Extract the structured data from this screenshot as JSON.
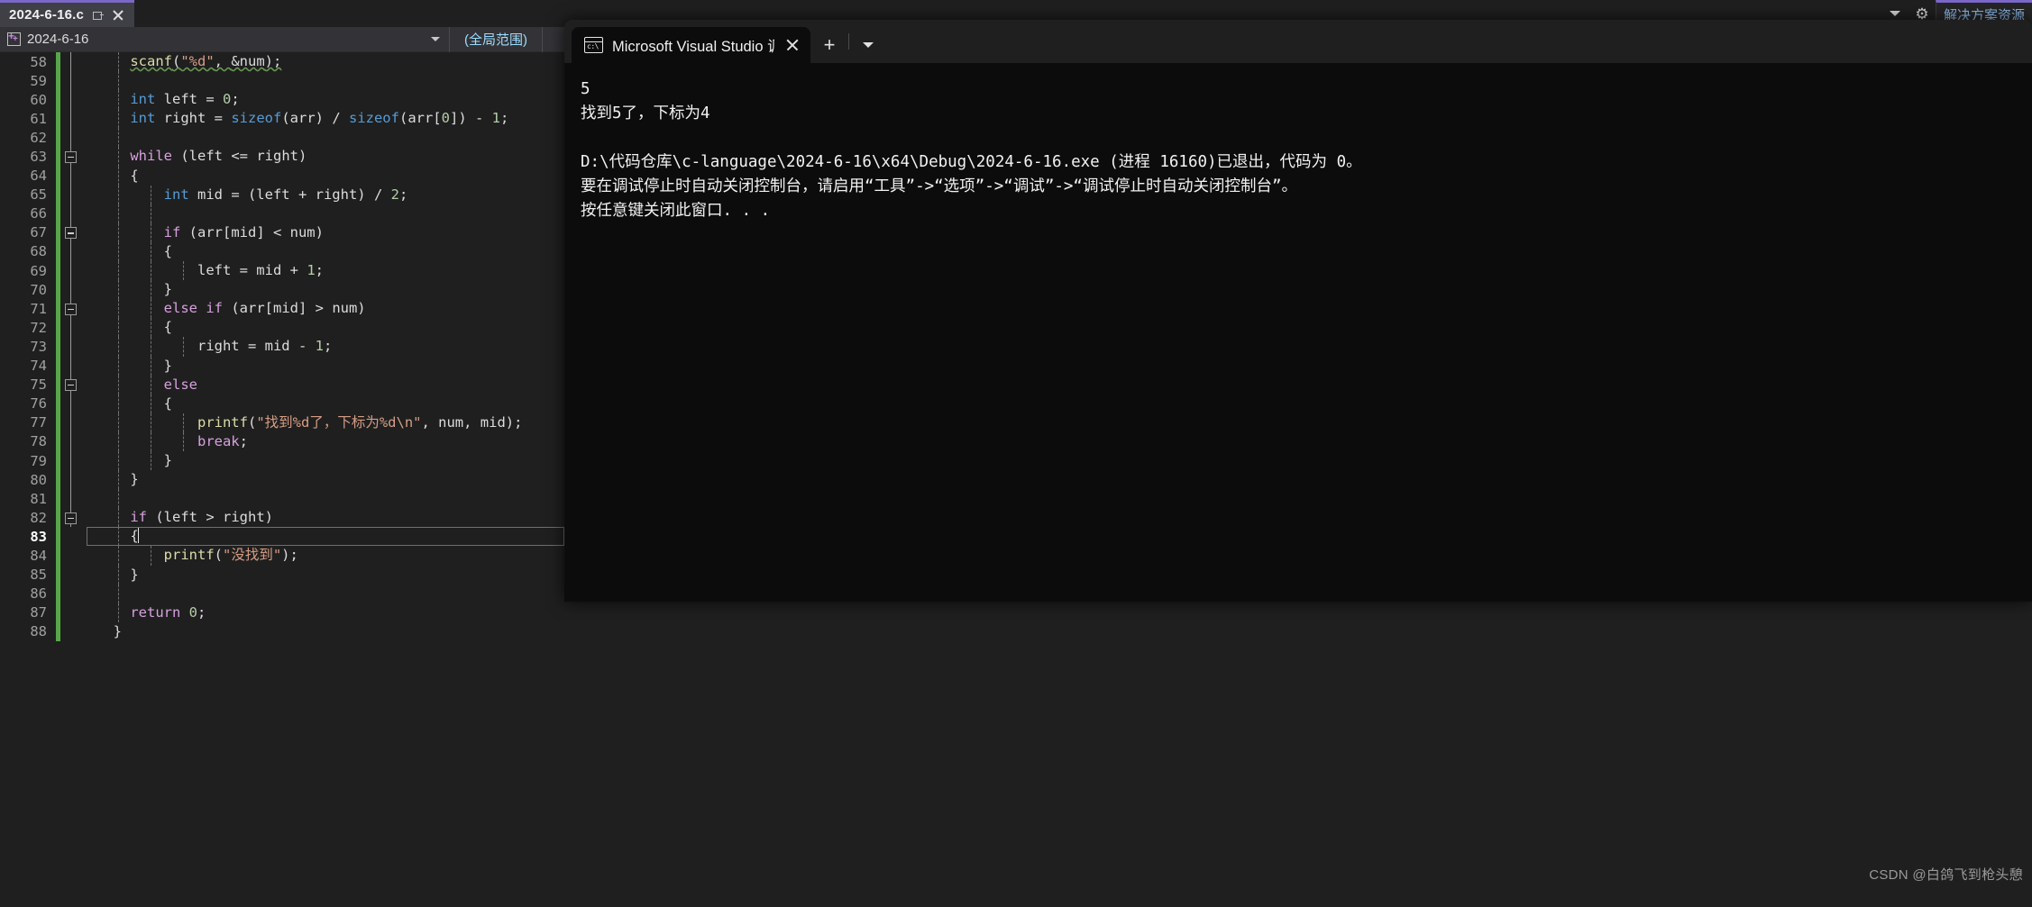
{
  "window": {
    "document_tab": {
      "title": "2024-6-16.c",
      "pin_label": "pin-tab",
      "close_label": "close-tab"
    },
    "tabstrip_right": {
      "dropdown_label": "active-files-dropdown",
      "settings_label": "settings",
      "solution_explorer_tab": "解决方案资源"
    }
  },
  "navbar": {
    "project": "2024-6-16",
    "scope": "(全局范围)"
  },
  "editor": {
    "first_line_number": 58,
    "current_line": 83,
    "lines": [
      {
        "n": 58,
        "fold": false,
        "rail": true,
        "indent_guides": 1,
        "indent": 2,
        "tokens": [
          {
            "t": "scanf",
            "c": "fn",
            "sq": true
          },
          {
            "t": "(",
            "c": "pl",
            "sq": true
          },
          {
            "t": "\"%d\"",
            "c": "str",
            "sq": true
          },
          {
            "t": ", ",
            "c": "pl",
            "sq": true
          },
          {
            "t": "&num",
            "c": "pl",
            "sq": true
          },
          {
            "t": ");",
            "c": "pl",
            "sq": true
          }
        ]
      },
      {
        "n": 59,
        "fold": false,
        "rail": true,
        "indent_guides": 1,
        "indent": 0,
        "tokens": []
      },
      {
        "n": 60,
        "fold": false,
        "rail": true,
        "indent_guides": 1,
        "indent": 2,
        "tokens": [
          {
            "t": "int",
            "c": "kw"
          },
          {
            "t": " left = ",
            "c": "pl"
          },
          {
            "t": "0",
            "c": "num"
          },
          {
            "t": ";",
            "c": "pl"
          }
        ]
      },
      {
        "n": 61,
        "fold": false,
        "rail": true,
        "indent_guides": 1,
        "indent": 2,
        "tokens": [
          {
            "t": "int",
            "c": "kw"
          },
          {
            "t": " right = ",
            "c": "pl"
          },
          {
            "t": "sizeof",
            "c": "kw"
          },
          {
            "t": "(arr) / ",
            "c": "pl"
          },
          {
            "t": "sizeof",
            "c": "kw"
          },
          {
            "t": "(arr[",
            "c": "pl"
          },
          {
            "t": "0",
            "c": "num"
          },
          {
            "t": "]) - ",
            "c": "pl"
          },
          {
            "t": "1",
            "c": "num"
          },
          {
            "t": ";",
            "c": "pl"
          }
        ]
      },
      {
        "n": 62,
        "fold": false,
        "rail": true,
        "indent_guides": 1,
        "indent": 0,
        "tokens": []
      },
      {
        "n": 63,
        "fold": true,
        "rail": true,
        "indent_guides": 1,
        "indent": 2,
        "tokens": [
          {
            "t": "while",
            "c": "ctl"
          },
          {
            "t": " (left <= right)",
            "c": "pl"
          }
        ]
      },
      {
        "n": 64,
        "fold": false,
        "rail": true,
        "indent_guides": 1,
        "indent": 2,
        "tokens": [
          {
            "t": "{",
            "c": "pl"
          }
        ]
      },
      {
        "n": 65,
        "fold": false,
        "rail": true,
        "indent_guides": 2,
        "indent": 4,
        "tokens": [
          {
            "t": "int",
            "c": "kw"
          },
          {
            "t": " mid = (left + right) / ",
            "c": "pl"
          },
          {
            "t": "2",
            "c": "num"
          },
          {
            "t": ";",
            "c": "pl"
          }
        ]
      },
      {
        "n": 66,
        "fold": false,
        "rail": true,
        "indent_guides": 2,
        "indent": 0,
        "tokens": []
      },
      {
        "n": 67,
        "fold": true,
        "rail": true,
        "indent_guides": 2,
        "indent": 4,
        "tokens": [
          {
            "t": "if",
            "c": "ctl"
          },
          {
            "t": " (arr[mid] < num)",
            "c": "pl"
          }
        ]
      },
      {
        "n": 68,
        "fold": false,
        "rail": true,
        "indent_guides": 2,
        "indent": 4,
        "tokens": [
          {
            "t": "{",
            "c": "pl"
          }
        ]
      },
      {
        "n": 69,
        "fold": false,
        "rail": true,
        "indent_guides": 3,
        "indent": 6,
        "tokens": [
          {
            "t": "left = mid + ",
            "c": "pl"
          },
          {
            "t": "1",
            "c": "num"
          },
          {
            "t": ";",
            "c": "pl"
          }
        ]
      },
      {
        "n": 70,
        "fold": false,
        "rail": true,
        "indent_guides": 2,
        "indent": 4,
        "tokens": [
          {
            "t": "}",
            "c": "pl"
          }
        ]
      },
      {
        "n": 71,
        "fold": true,
        "rail": true,
        "indent_guides": 2,
        "indent": 4,
        "tokens": [
          {
            "t": "else",
            "c": "ctl"
          },
          {
            "t": " ",
            "c": "pl"
          },
          {
            "t": "if",
            "c": "ctl"
          },
          {
            "t": " (arr[mid] > num)",
            "c": "pl"
          }
        ]
      },
      {
        "n": 72,
        "fold": false,
        "rail": true,
        "indent_guides": 2,
        "indent": 4,
        "tokens": [
          {
            "t": "{",
            "c": "pl"
          }
        ]
      },
      {
        "n": 73,
        "fold": false,
        "rail": true,
        "indent_guides": 3,
        "indent": 6,
        "tokens": [
          {
            "t": "right = mid - ",
            "c": "pl"
          },
          {
            "t": "1",
            "c": "num"
          },
          {
            "t": ";",
            "c": "pl"
          }
        ]
      },
      {
        "n": 74,
        "fold": false,
        "rail": true,
        "indent_guides": 2,
        "indent": 4,
        "tokens": [
          {
            "t": "}",
            "c": "pl"
          }
        ]
      },
      {
        "n": 75,
        "fold": true,
        "rail": true,
        "indent_guides": 2,
        "indent": 4,
        "tokens": [
          {
            "t": "else",
            "c": "ctl"
          }
        ]
      },
      {
        "n": 76,
        "fold": false,
        "rail": true,
        "indent_guides": 2,
        "indent": 4,
        "tokens": [
          {
            "t": "{",
            "c": "pl"
          }
        ]
      },
      {
        "n": 77,
        "fold": false,
        "rail": true,
        "indent_guides": 3,
        "indent": 6,
        "tokens": [
          {
            "t": "printf",
            "c": "fn"
          },
          {
            "t": "(",
            "c": "pl"
          },
          {
            "t": "\"找到%d了，下标为%d\\n\"",
            "c": "str"
          },
          {
            "t": ", num, mid);",
            "c": "pl"
          }
        ]
      },
      {
        "n": 78,
        "fold": false,
        "rail": true,
        "indent_guides": 3,
        "indent": 6,
        "tokens": [
          {
            "t": "break",
            "c": "ctl"
          },
          {
            "t": ";",
            "c": "pl"
          }
        ]
      },
      {
        "n": 79,
        "fold": false,
        "rail": true,
        "indent_guides": 2,
        "indent": 4,
        "tokens": [
          {
            "t": "}",
            "c": "pl"
          }
        ]
      },
      {
        "n": 80,
        "fold": false,
        "rail": true,
        "indent_guides": 1,
        "indent": 2,
        "tokens": [
          {
            "t": "}",
            "c": "pl"
          }
        ]
      },
      {
        "n": 81,
        "fold": false,
        "rail": true,
        "indent_guides": 1,
        "indent": 0,
        "tokens": []
      },
      {
        "n": 82,
        "fold": true,
        "rail": true,
        "indent_guides": 1,
        "indent": 2,
        "tokens": [
          {
            "t": "if",
            "c": "ctl"
          },
          {
            "t": " (left > right)",
            "c": "pl"
          }
        ]
      },
      {
        "n": 83,
        "fold": false,
        "rail": false,
        "indent_guides": 1,
        "indent": 2,
        "current": true,
        "tokens": [
          {
            "t": "{",
            "c": "pl"
          }
        ]
      },
      {
        "n": 84,
        "fold": false,
        "rail": false,
        "indent_guides": 2,
        "indent": 4,
        "tokens": [
          {
            "t": "printf",
            "c": "fn"
          },
          {
            "t": "(",
            "c": "pl"
          },
          {
            "t": "\"没找到\"",
            "c": "str"
          },
          {
            "t": ");",
            "c": "pl"
          }
        ]
      },
      {
        "n": 85,
        "fold": false,
        "rail": false,
        "indent_guides": 1,
        "indent": 2,
        "tokens": [
          {
            "t": "}",
            "c": "pl"
          }
        ]
      },
      {
        "n": 86,
        "fold": false,
        "rail": false,
        "indent_guides": 1,
        "indent": 0,
        "tokens": []
      },
      {
        "n": 87,
        "fold": false,
        "rail": false,
        "indent_guides": 1,
        "indent": 2,
        "tokens": [
          {
            "t": "return",
            "c": "ctl"
          },
          {
            "t": " ",
            "c": "pl"
          },
          {
            "t": "0",
            "c": "num"
          },
          {
            "t": ";",
            "c": "pl"
          }
        ]
      },
      {
        "n": 88,
        "fold": false,
        "rail": false,
        "indent_guides": 0,
        "indent": 1,
        "tokens": [
          {
            "t": "}",
            "c": "pl"
          }
        ]
      }
    ]
  },
  "console": {
    "tab_title": "Microsoft Visual Studio 调试控",
    "icon_label": "c:\\",
    "new_tab_label": "+",
    "output_lines": [
      "5",
      "找到5了，下标为4",
      "",
      "D:\\代码仓库\\c-language\\2024-6-16\\x64\\Debug\\2024-6-16.exe (进程 16160)已退出，代码为 0。",
      "要在调试停止时自动关闭控制台，请启用“工具”->“选项”->“调试”->“调试停止时自动关闭控制台”。",
      "按任意键关闭此窗口. . ."
    ]
  },
  "watermark": "CSDN @白鸽飞到枪头憩"
}
